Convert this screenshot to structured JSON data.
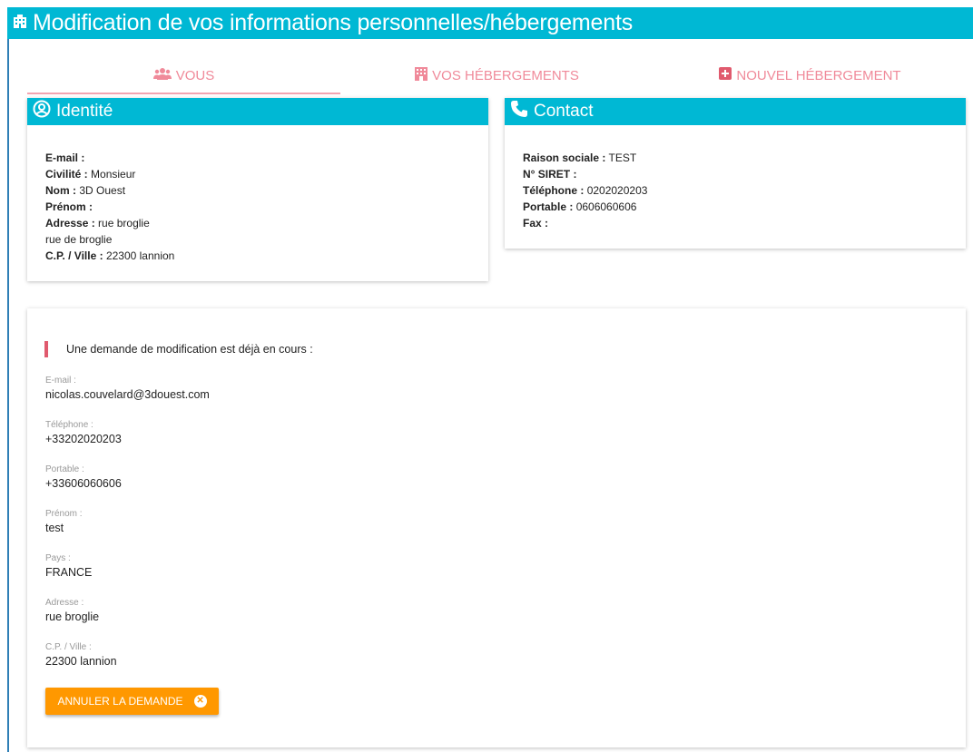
{
  "header": {
    "title": "Modification de vos informations personnelles/hébergements",
    "icon": "building-icon"
  },
  "tabs": [
    {
      "label": "VOUS",
      "icon": "users-icon",
      "active": true
    },
    {
      "label": "VOS HÉBERGEMENTS",
      "icon": "hotel-icon",
      "active": false
    },
    {
      "label": "NOUVEL HÉBERGEMENT",
      "icon": "plus-square-icon",
      "active": false
    }
  ],
  "identity": {
    "title": "Identité",
    "rows": [
      {
        "label": "E-mail :",
        "value": ""
      },
      {
        "label": "Civilité :",
        "value": "Monsieur"
      },
      {
        "label": "Nom :",
        "value": "3D Ouest"
      },
      {
        "label": "Prénom :",
        "value": ""
      },
      {
        "label": "Adresse :",
        "value": "rue broglie"
      },
      {
        "label": "",
        "value": "rue de broglie"
      },
      {
        "label": "C.P. / Ville :",
        "value": "22300 lannion"
      }
    ]
  },
  "contact": {
    "title": "Contact",
    "rows": [
      {
        "label": "Raison sociale :",
        "value": "TEST"
      },
      {
        "label": "N° SIRET :",
        "value": ""
      },
      {
        "label": "Téléphone :",
        "value": "0202020203"
      },
      {
        "label": "Portable :",
        "value": "0606060606"
      },
      {
        "label": "Fax :",
        "value": ""
      }
    ]
  },
  "request": {
    "notice": "Une demande de modification est déjà en cours :",
    "fields": [
      {
        "label": "E-mail :",
        "value": "nicolas.couvelard@3douest.com"
      },
      {
        "label": "Téléphone :",
        "value": "+33202020203"
      },
      {
        "label": "Portable :",
        "value": "+33606060606"
      },
      {
        "label": "Prénom :",
        "value": "test"
      },
      {
        "label": "Pays :",
        "value": "FRANCE"
      },
      {
        "label": "Adresse :",
        "value": "rue broglie"
      },
      {
        "label": "C.P. / Ville :",
        "value": "22300 lannion"
      }
    ],
    "cancel_label": "ANNULER LA DEMANDE"
  },
  "colors": {
    "primary": "#00b8d4",
    "tab_accent": "#f08a9a",
    "button": "#ff9800",
    "notice_bar": "#e05a6e"
  }
}
